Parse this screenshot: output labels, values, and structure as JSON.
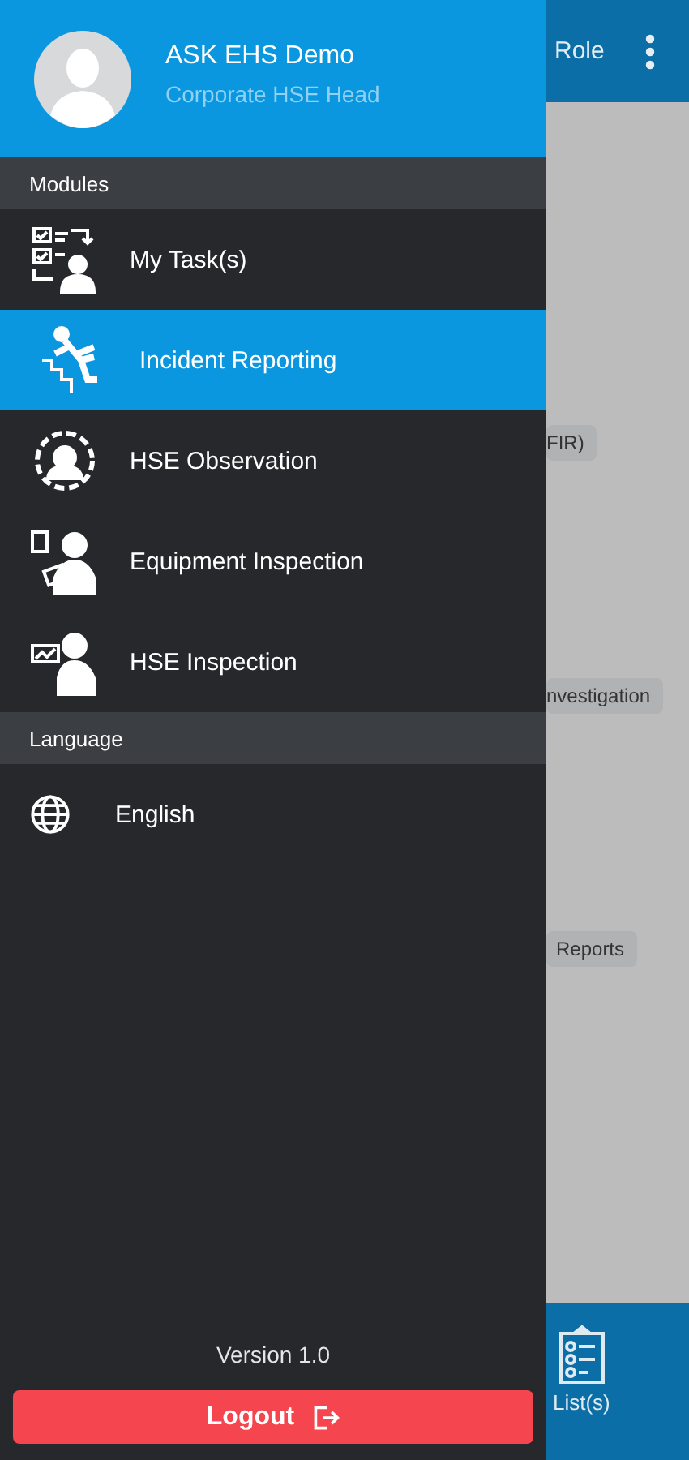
{
  "drawer": {
    "user": {
      "name": "ASK EHS Demo",
      "role": "Corporate HSE Head"
    },
    "sections": [
      {
        "title": "Modules",
        "items": [
          {
            "label": "My Task(s)",
            "kind": "tasks",
            "selected": false
          },
          {
            "label": "Incident Reporting",
            "kind": "fall",
            "selected": true
          },
          {
            "label": "HSE Observation",
            "kind": "observation",
            "selected": false
          },
          {
            "label": "Equipment Inspection",
            "kind": "equipment",
            "selected": false
          },
          {
            "label": "HSE Inspection",
            "kind": "inspection",
            "selected": false
          }
        ]
      },
      {
        "title": "Language",
        "items": [
          {
            "label": "English",
            "kind": "language",
            "selected": false
          }
        ]
      }
    ],
    "version": "Version 1.0",
    "logout": "Logout"
  },
  "background": {
    "app_bar_title": "Role",
    "chips": [
      "FIR)",
      "nvestigation",
      "Reports"
    ],
    "bottom_tab": "List(s)"
  }
}
